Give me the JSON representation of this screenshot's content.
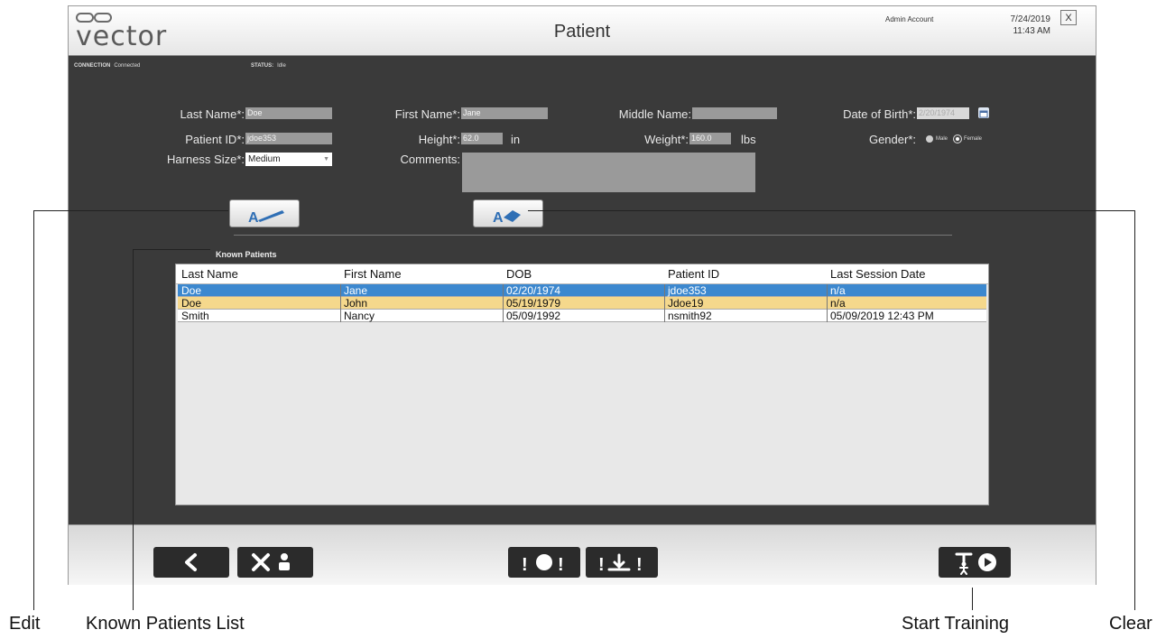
{
  "header": {
    "logo_text": "vector",
    "title": "Patient",
    "account": "Admin Account",
    "date": "7/24/2019",
    "time": "11:43 AM",
    "close_label": "X"
  },
  "status": {
    "connection_label": "CONNECTION",
    "connection_value": "Connected",
    "status_label": "STATUS:",
    "status_value": "Idle"
  },
  "form": {
    "last_name_label": "Last Name*:",
    "last_name": "Doe",
    "first_name_label": "First Name*:",
    "first_name": "Jane",
    "middle_name_label": "Middle Name:",
    "middle_name": "",
    "dob_label": "Date of Birth*:",
    "dob": "2/20/1974",
    "patient_id_label": "Patient ID*:",
    "patient_id": "jdoe353",
    "height_label": "Height*:",
    "height": "62.0",
    "height_unit": "in",
    "weight_label": "Weight*:",
    "weight": "160.0",
    "weight_unit": "lbs",
    "gender_label": "Gender*:",
    "gender_options": [
      "Male",
      "Female"
    ],
    "gender_selected": "Female",
    "harness_label": "Harness Size*:",
    "harness": "Medium",
    "comments_label": "Comments:",
    "comments": ""
  },
  "known_patients": {
    "title": "Known Patients",
    "columns": [
      "Last Name",
      "First Name",
      "DOB",
      "Patient ID",
      "Last Session Date"
    ],
    "rows": [
      [
        "Doe",
        "Jane",
        "02/20/1974",
        "jdoe353",
        "n/a"
      ],
      [
        "Doe",
        "John",
        "05/19/1979",
        "Jdoe19",
        "n/a"
      ],
      [
        "Smith",
        "Nancy",
        "05/09/1992",
        "nsmith92",
        "05/09/2019 12:43 PM"
      ]
    ]
  },
  "callouts": {
    "edit": "Edit",
    "known_patients_list": "Known Patients List",
    "start_training": "Start Training",
    "clear": "Clear"
  },
  "colors": {
    "panel": "#3a3a3a",
    "selected_row": "#3c88cf",
    "highlight_row": "#f5d88c"
  }
}
